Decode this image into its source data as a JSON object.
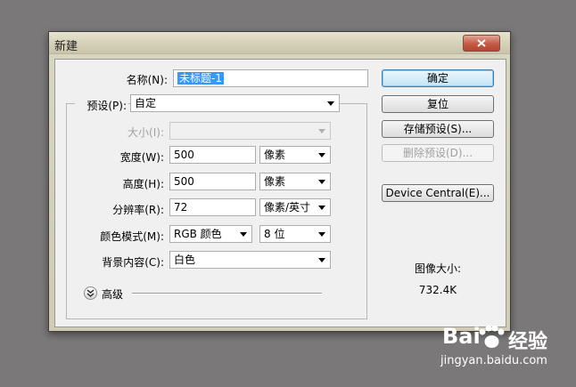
{
  "dialog": {
    "title": "新建",
    "name_label": "名称(N):",
    "name_value": "未标题-1",
    "preset_label": "预设(P):",
    "preset_value": "自定",
    "size_label": "大小(I):",
    "width_label": "宽度(W):",
    "width_value": "500",
    "width_unit": "像素",
    "height_label": "高度(H):",
    "height_value": "500",
    "height_unit": "像素",
    "resolution_label": "分辨率(R):",
    "resolution_value": "72",
    "resolution_unit": "像素/英寸",
    "color_mode_label": "颜色模式(M):",
    "color_mode_value": "RGB 颜色",
    "bit_depth_value": "8 位",
    "background_label": "背景内容(C):",
    "background_value": "白色",
    "advanced_label": "高级",
    "buttons": {
      "ok": "确定",
      "reset": "复位",
      "save_preset": "存储预设(S)...",
      "delete_preset": "删除预设(D)...",
      "device_central": "Device Central(E)..."
    },
    "image_size_label": "图像大小:",
    "image_size_value": "732.4K"
  },
  "watermark": {
    "logo": "Bai",
    "logo_suffix": "经验",
    "url": "jingyan.baidu.com"
  },
  "colors": {
    "desktop": "#7a7879",
    "dialog_frame": "#d9d6c3",
    "selection": "#3399ff",
    "close_button": "#c45a45"
  },
  "icons": {
    "close": "close-icon",
    "dropdown": "chevron-down-icon",
    "expand": "double-chevron-down-icon",
    "watermark": "paw-icon"
  }
}
